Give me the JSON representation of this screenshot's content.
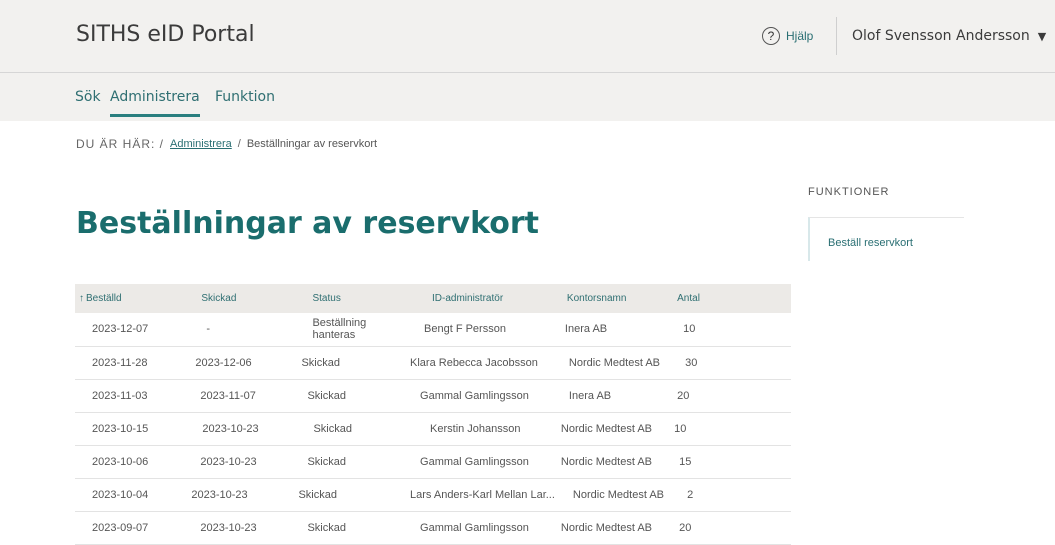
{
  "header": {
    "app_title": "SITHS eID Portal",
    "help_label": "Hjälp",
    "help_icon": "?",
    "user_name": "Olof Svensson Andersson",
    "user_menu_icon": "chevron-down"
  },
  "nav": {
    "items": [
      {
        "label": "Sök",
        "active": false
      },
      {
        "label": "Administrera",
        "active": true
      },
      {
        "label": "Funktion",
        "active": false
      }
    ]
  },
  "breadcrumb": {
    "prefix": "DU ÄR HÄR: /",
    "link": "Administrera",
    "separator": "/",
    "current": "Beställningar av reservkort"
  },
  "main": {
    "title": "Beställningar av reservkort"
  },
  "functions": {
    "heading": "FUNKTIONER",
    "link": "Beställ reservkort"
  },
  "table": {
    "sort_arrow": "↑",
    "headers": [
      "Beställd",
      "Skickad",
      "Status",
      "ID-administratör",
      "Kontorsnamn",
      "Antal"
    ],
    "rows": [
      [
        "2023-12-07",
        "-",
        "Beställning hanteras",
        "Bengt F Persson",
        "Inera AB",
        "10"
      ],
      [
        "2023-11-28",
        "2023-12-06",
        "Skickad",
        "Klara Rebecca Jacobsson",
        "Nordic Medtest AB",
        "30"
      ],
      [
        "2023-11-03",
        "2023-11-07",
        "Skickad",
        "Gammal Gamlingsson",
        "Inera AB",
        "20"
      ],
      [
        "2023-10-15",
        "2023-10-23",
        "Skickad",
        "Kerstin Johansson",
        "Nordic Medtest AB",
        "10"
      ],
      [
        "2023-10-06",
        "2023-10-23",
        "Skickad",
        "Gammal Gamlingsson",
        "Nordic Medtest AB",
        "15"
      ],
      [
        "2023-10-04",
        "2023-10-23",
        "Skickad",
        "Lars Anders-Karl Mellan Lar...",
        "Nordic Medtest AB",
        "2"
      ],
      [
        "2023-09-07",
        "2023-10-23",
        "Skickad",
        "Gammal Gamlingsson",
        "Nordic Medtest AB",
        "20"
      ]
    ]
  },
  "colors": {
    "accent": "#1a6d6d",
    "header_bg": "#f2f1ef",
    "table_header_bg": "#eceae7"
  }
}
